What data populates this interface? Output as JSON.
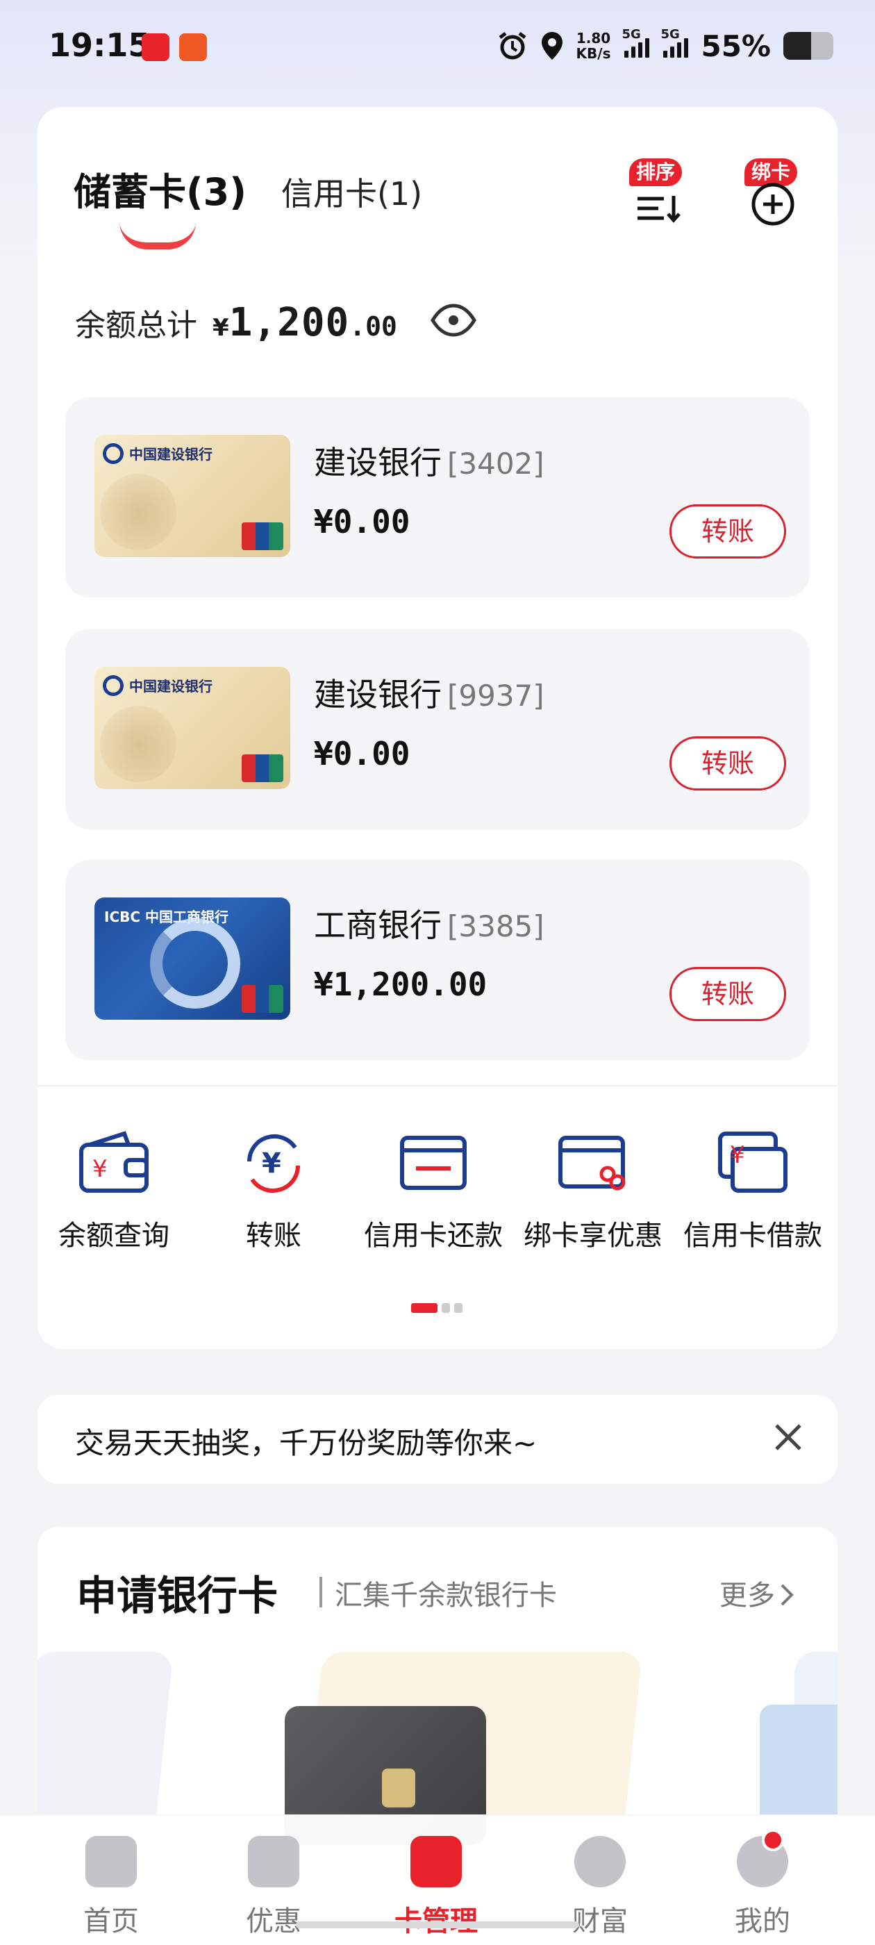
{
  "status_bar": {
    "time": "19:15",
    "net_speed": "1.80",
    "net_unit": "KB/s",
    "sig1_label": "5G",
    "sig2_label": "5G",
    "battery_pct": "55%",
    "battery_level": 0.55
  },
  "tabs": {
    "debit": "储蓄卡(3)",
    "credit": "信用卡(1)",
    "sort_badge": "排序",
    "bind_badge": "绑卡"
  },
  "total": {
    "label": "余额总计",
    "yen": "¥",
    "int": "1,200",
    "dec": ".00"
  },
  "accounts": [
    {
      "bank": "建设银行",
      "num": "[3402]",
      "balance": "¥0.00",
      "action": "转账",
      "card_label": "中国建设银行"
    },
    {
      "bank": "建设银行",
      "num": "[9937]",
      "balance": "¥0.00",
      "action": "转账",
      "card_label": "中国建设银行"
    },
    {
      "bank": "工商银行",
      "num": "[3385]",
      "balance": "¥1,200.00",
      "action": "转账",
      "card_label": "ICBC 中国工商银行"
    }
  ],
  "quick_actions": [
    {
      "label": "余额查询",
      "icon": "wallet-icon"
    },
    {
      "label": "转账",
      "icon": "transfer-icon"
    },
    {
      "label": "信用卡还款",
      "icon": "card-repay-icon"
    },
    {
      "label": "绑卡享优惠",
      "icon": "bind-card-icon"
    },
    {
      "label": "信用卡借款",
      "icon": "card-loan-icon"
    }
  ],
  "promo": {
    "text": "交易天天抽奖，千万份奖励等你来~"
  },
  "apply": {
    "title": "申请银行卡",
    "subtitle": "汇集千余款银行卡",
    "more": "更多"
  },
  "tabbar": [
    {
      "label": "首页",
      "icon": "home-icon"
    },
    {
      "label": "优惠",
      "icon": "coupon-icon"
    },
    {
      "label": "卡管理",
      "icon": "card-icon"
    },
    {
      "label": "财富",
      "icon": "wealth-icon"
    },
    {
      "label": "我的",
      "icon": "profile-icon"
    }
  ],
  "colors": {
    "accent": "#e8222c",
    "navy": "#1c3d8f"
  }
}
